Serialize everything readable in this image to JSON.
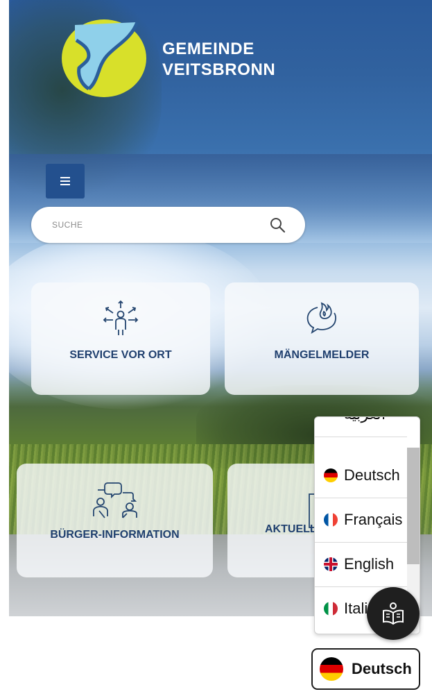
{
  "header": {
    "brand_line1": "GEMEINDE",
    "brand_line2": "VEITSBRONN",
    "menu_icon": "hamburger-icon"
  },
  "search": {
    "placeholder": "SUCHE",
    "value": "",
    "icon": "search-icon"
  },
  "tiles": [
    {
      "label": "SERVICE VOR ORT",
      "icon": "person-arrows-icon"
    },
    {
      "label": "MÄNGELMELDER",
      "icon": "chat-fire-icon"
    },
    {
      "label": "BÜRGER-INFORMATION",
      "icon": "people-chat-icon"
    },
    {
      "label": "AKTUELLES",
      "icon": "document-icon"
    }
  ],
  "language_menu": {
    "items": [
      {
        "label": "العربية",
        "flag": "flag-ar"
      },
      {
        "label": "Deutsch",
        "flag": "flag-de"
      },
      {
        "label": "Français",
        "flag": "flag-fr"
      },
      {
        "label": "English",
        "flag": "flag-gb"
      },
      {
        "label": "Italiano",
        "flag": "flag-it"
      }
    ]
  },
  "reader_button": {
    "icon": "reader-book-icon"
  },
  "language_button": {
    "label": "Deutsch",
    "flag": "flag-de"
  },
  "colors": {
    "brand_blue": "#23508e",
    "logo_yellow": "#d8e02a",
    "logo_light_blue": "#8fd0ea"
  }
}
